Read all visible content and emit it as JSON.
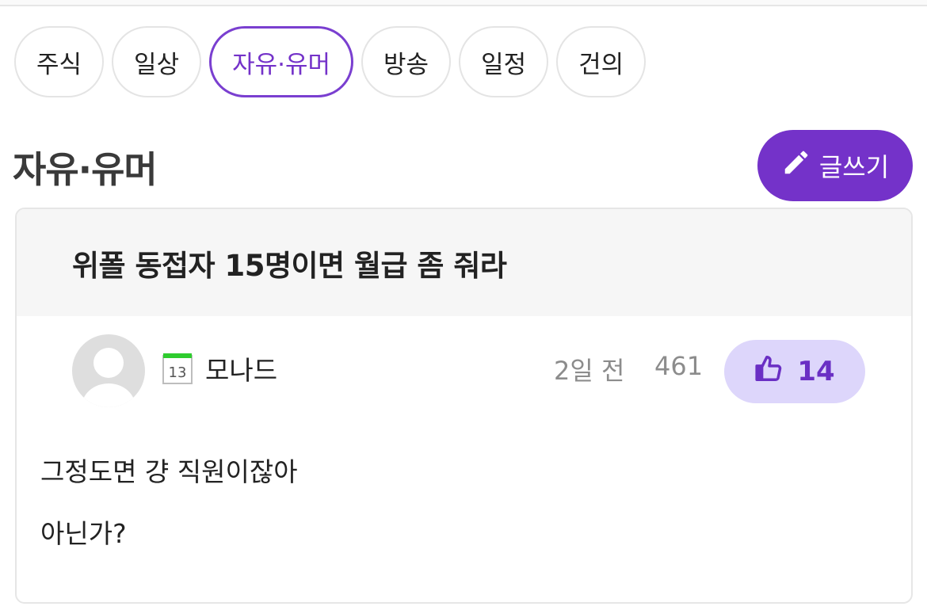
{
  "tabs": [
    {
      "label": "주식"
    },
    {
      "label": "일상"
    },
    {
      "label": "자유·유머",
      "active": true
    },
    {
      "label": "방송"
    },
    {
      "label": "일정"
    },
    {
      "label": "건의"
    }
  ],
  "page": {
    "title": "자유·유머",
    "write_label": "글쓰기"
  },
  "post": {
    "title": "위폴 동접자 15명이면 월급 좀 줘라",
    "author": "모나드",
    "calendar_day": "13",
    "time": "2일 전",
    "views": "461",
    "likes": "14",
    "body": [
      "그정도면 걍 직원이잖아",
      "아닌가?"
    ]
  },
  "colors": {
    "accent": "#7432c9",
    "like_bg": "#ddd6fb",
    "header_bg": "#f6f6f6"
  },
  "icons": {
    "write": "pencil-icon",
    "like": "thumbs-up-icon",
    "calendar": "calendar-icon",
    "avatar": "user-avatar"
  }
}
